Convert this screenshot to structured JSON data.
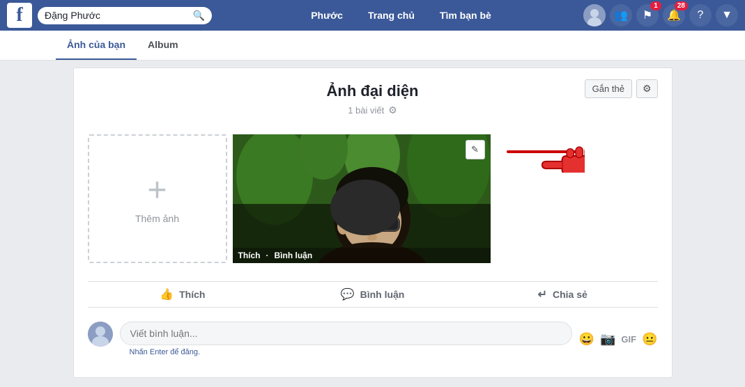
{
  "navbar": {
    "search_placeholder": "Đặng Phước",
    "logo_letter": "f",
    "links": [
      {
        "label": "Phước",
        "key": "profile"
      },
      {
        "label": "Trang chủ",
        "key": "home"
      },
      {
        "label": "Tìm bạn bè",
        "key": "friends"
      }
    ],
    "notification_count": 1,
    "alert_count": 28
  },
  "tabs": [
    {
      "label": "Ảnh của bạn",
      "active": true
    },
    {
      "label": "Album",
      "active": false
    }
  ],
  "photo_section": {
    "title": "Ảnh đại diện",
    "post_count": "1 bài viết",
    "tag_button": "Gắn thẻ",
    "add_label": "Thêm ảnh"
  },
  "overlay": {
    "like": "Thích",
    "comment": "Bình luận"
  },
  "actions": {
    "like": "Thích",
    "comment": "Bình luận",
    "share": "Chia sẻ"
  },
  "comment_box": {
    "placeholder": "Viết bình luận...",
    "hint": "Nhấn Enter để đăng."
  },
  "annotation": {
    "text": "Gắn thẻ"
  }
}
